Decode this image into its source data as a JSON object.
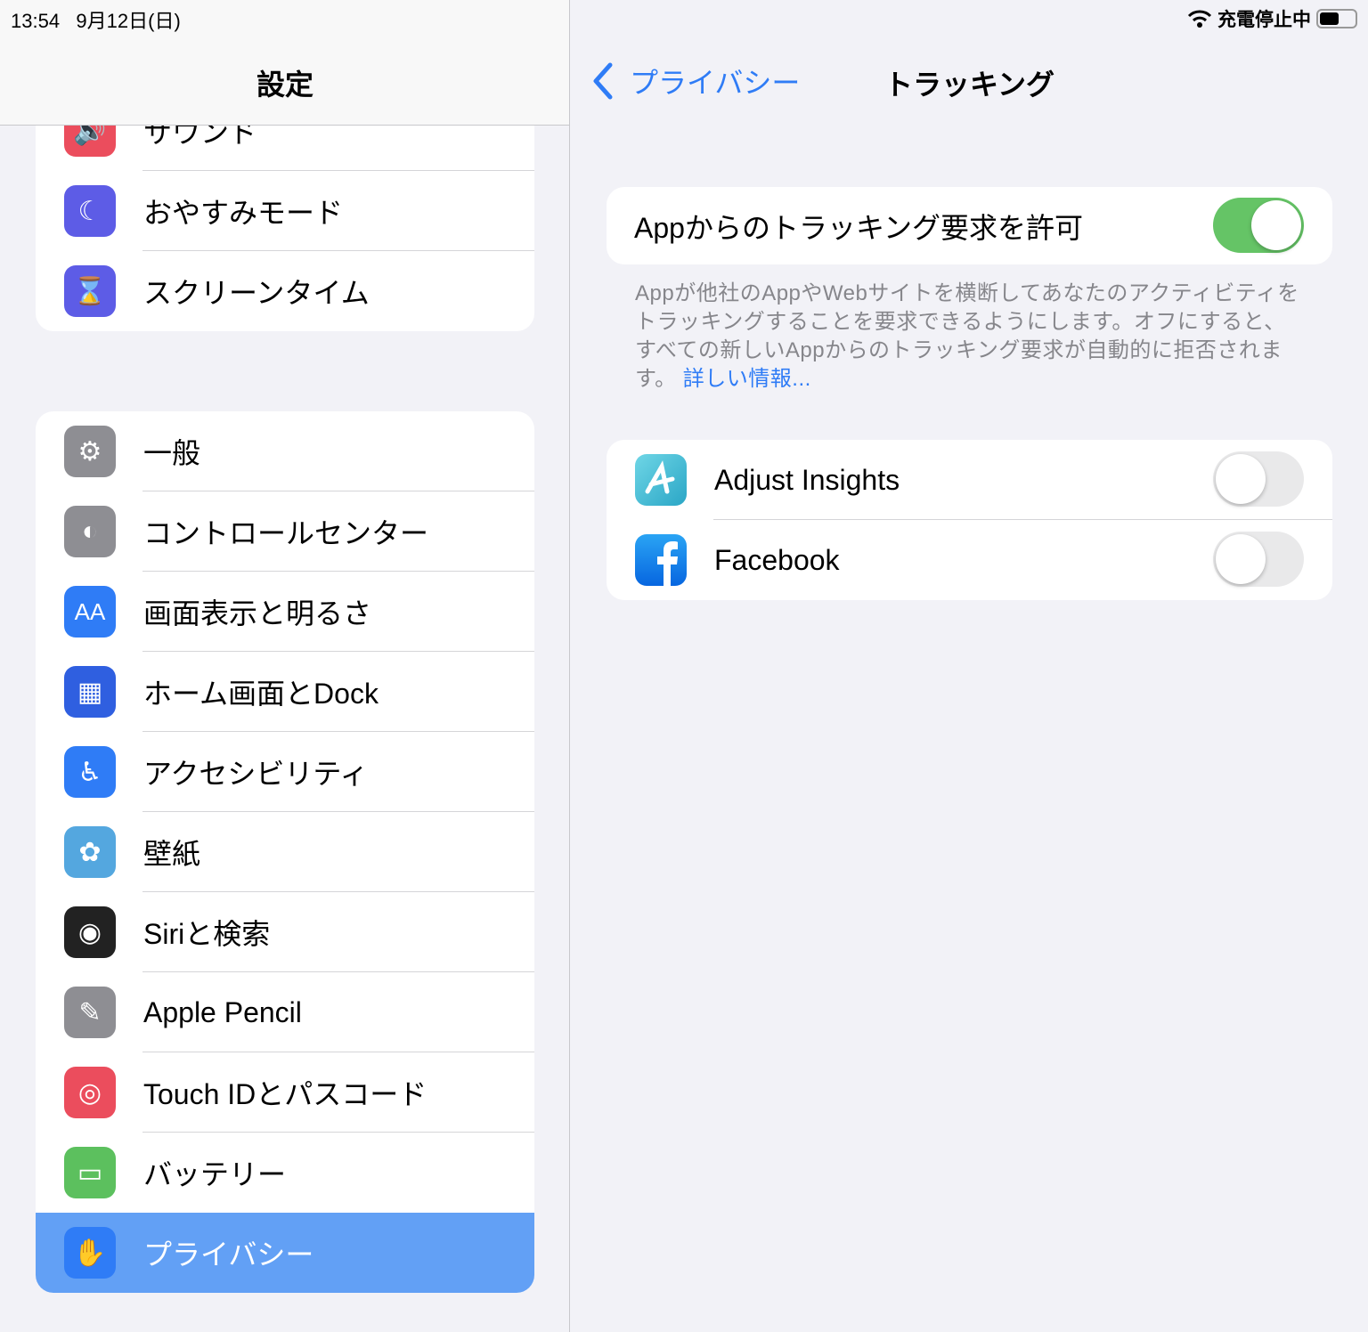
{
  "status": {
    "time": "13:54",
    "date": "9月12日(日)",
    "charging": "充電停止中",
    "battery_level": 0.55
  },
  "sidebar": {
    "title": "設定",
    "group1": [
      {
        "label": "サウンド",
        "icon": "speaker-icon",
        "color": "#eb4d5d"
      },
      {
        "label": "おやすみモード",
        "icon": "moon-icon",
        "color": "#5d5ce6"
      },
      {
        "label": "スクリーンタイム",
        "icon": "hourglass-icon",
        "color": "#5d5ce6"
      }
    ],
    "group2": [
      {
        "label": "一般",
        "icon": "gear-icon",
        "color": "#8e8e93"
      },
      {
        "label": "コントロールセンター",
        "icon": "switches-icon",
        "color": "#8e8e93"
      },
      {
        "label": "画面表示と明るさ",
        "icon": "text-size-icon",
        "color": "#2f7cf6"
      },
      {
        "label": "ホーム画面とDock",
        "icon": "home-grid-icon",
        "color": "#2f5fe0"
      },
      {
        "label": "アクセシビリティ",
        "icon": "accessibility-icon",
        "color": "#2f7cf6"
      },
      {
        "label": "壁紙",
        "icon": "flower-icon",
        "color": "#54a7df"
      },
      {
        "label": "Siriと検索",
        "icon": "siri-icon",
        "color": "#222"
      },
      {
        "label": "Apple Pencil",
        "icon": "pencil-icon",
        "color": "#8e8e93"
      },
      {
        "label": "Touch IDとパスコード",
        "icon": "fingerprint-icon",
        "color": "#eb4d5d"
      },
      {
        "label": "バッテリー",
        "icon": "battery-icon",
        "color": "#5cc05e"
      },
      {
        "label": "プライバシー",
        "icon": "hand-icon",
        "color": "#2f7cf6",
        "selected": true
      }
    ]
  },
  "detail": {
    "back_label": "プライバシー",
    "title": "トラッキング",
    "allow": {
      "label": "Appからのトラッキング要求を許可",
      "on": true
    },
    "footer": "Appが他社のAppやWebサイトを横断してあなたのアクティビティをトラッキングすることを要求できるようにします。オフにすると、すべての新しいAppからのトラッキング要求が自動的に拒否されます。",
    "footer_link": "詳しい情報...",
    "apps": [
      {
        "name": "Adjust Insights",
        "on": false
      },
      {
        "name": "Facebook",
        "on": false
      }
    ]
  },
  "colors": {
    "accent": "#2f7cf6",
    "toggle_on": "#65c466",
    "selection": "#62a0f5"
  }
}
